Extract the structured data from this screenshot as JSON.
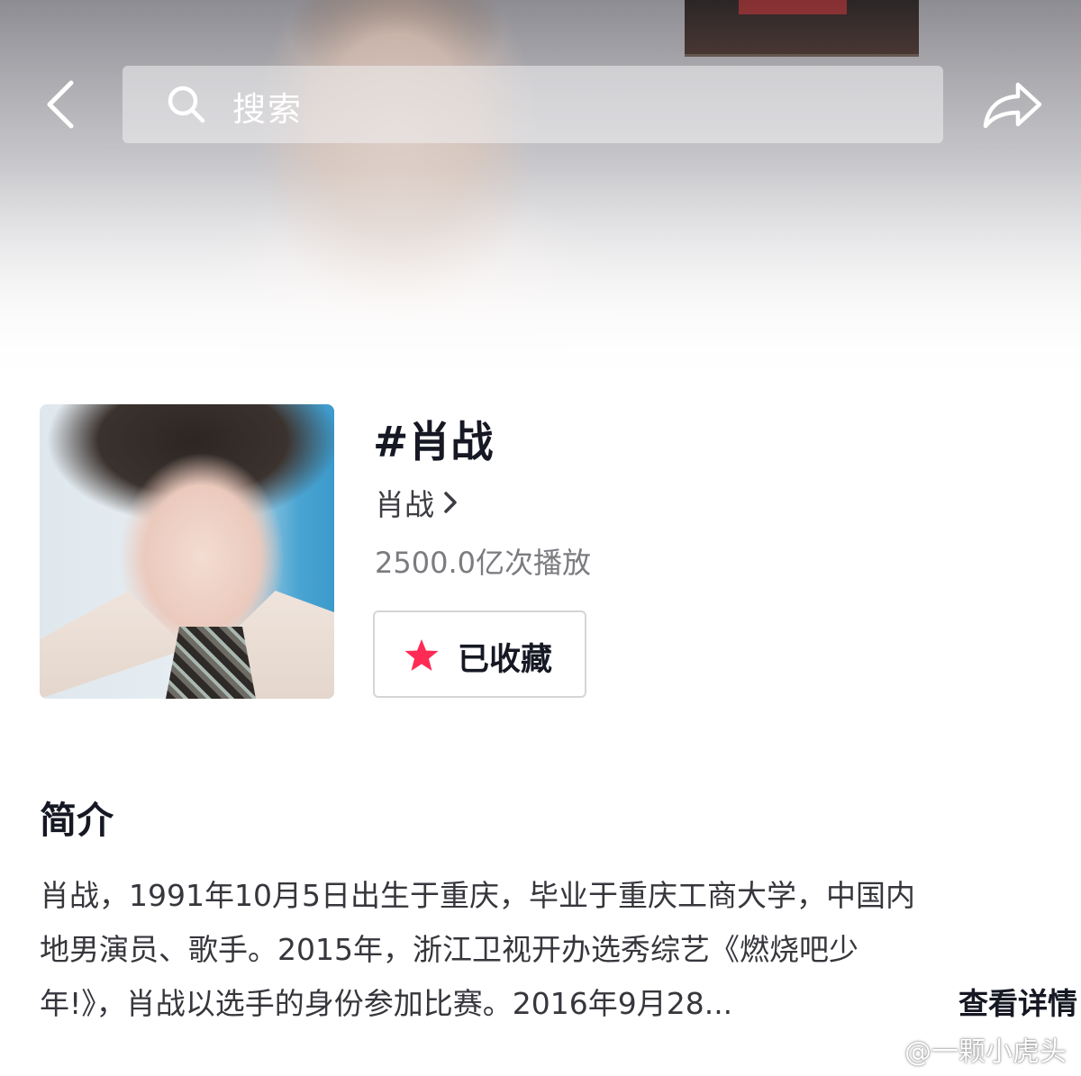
{
  "header": {
    "back_icon": "chevron-left-icon",
    "search_placeholder": "搜索",
    "search_icon": "search-icon",
    "share_icon": "share-icon"
  },
  "topic": {
    "title": "#肖战",
    "creator": "肖战",
    "play_count": "2500.0亿次播放",
    "favorite_label": "已收藏",
    "favorite_color": "#fe2c55"
  },
  "intro": {
    "heading": "简介",
    "lines": [
      "肖战，1991年10月5日出生于重庆，毕业于重庆工商大学，中国内",
      "地男演员、歌手。2015年，浙江卫视开办选秀综艺《燃烧吧少",
      "年!》，肖战以选手的身份参加比赛。2016年9月28..."
    ],
    "more_label": "查看详情"
  },
  "watermark": {
    "text": "@一颗小虎头"
  }
}
